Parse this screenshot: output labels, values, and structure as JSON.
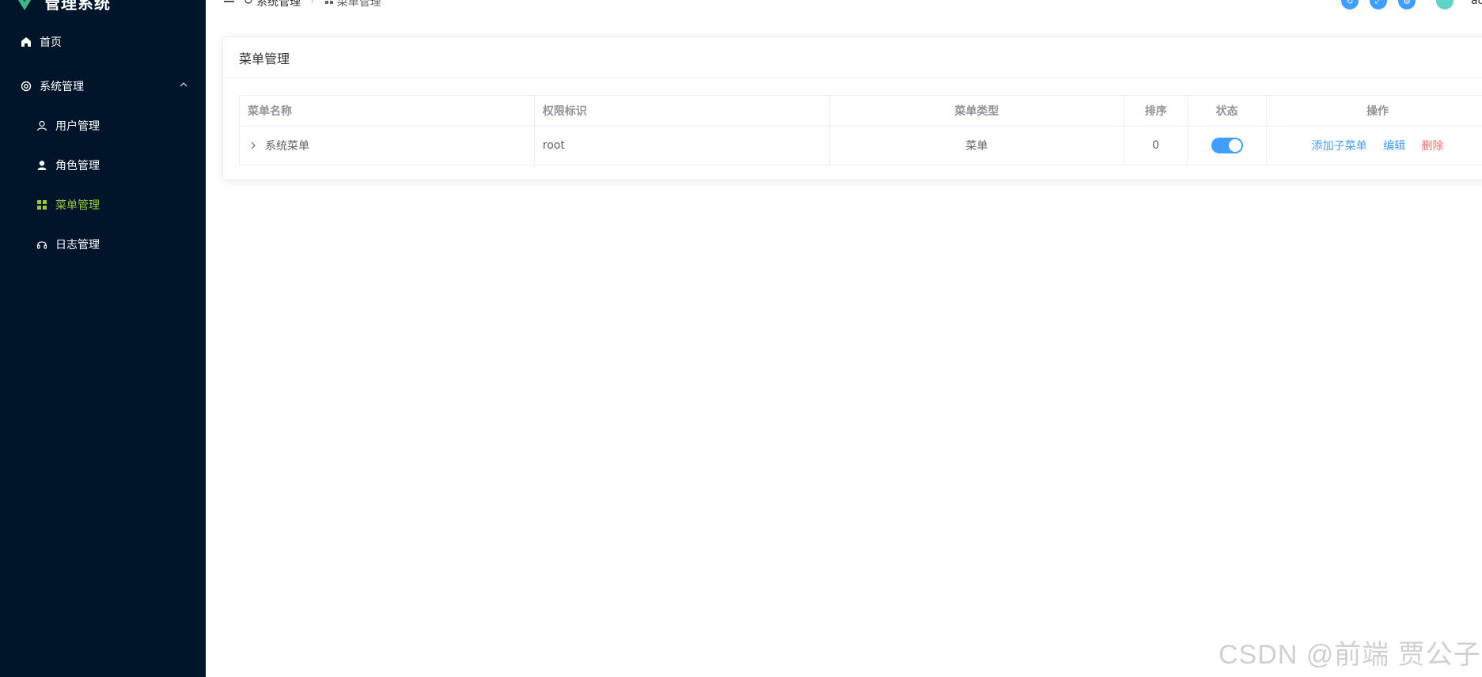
{
  "brand": {
    "title": "管理系统"
  },
  "sidebar": {
    "home_label": "首页",
    "group_label": "系统管理",
    "items": [
      {
        "label": "用户管理",
        "icon": "user-outline-icon"
      },
      {
        "label": "角色管理",
        "icon": "user-filled-icon"
      },
      {
        "label": "菜单管理",
        "icon": "grid-icon",
        "active": true
      },
      {
        "label": "日志管理",
        "icon": "headset-icon"
      }
    ],
    "active_color": "#93c83a"
  },
  "header": {
    "breadcrumb": [
      {
        "label": "系统管理",
        "icon": "gear-icon"
      },
      {
        "label": "菜单管理",
        "icon": "grid-icon"
      }
    ],
    "username": "ad"
  },
  "card": {
    "title": "菜单管理"
  },
  "table": {
    "headers": [
      "菜单名称",
      "权限标识",
      "菜单类型",
      "排序",
      "状态",
      "操作"
    ],
    "rows": [
      {
        "name": "系统菜单",
        "permission": "root",
        "type": "菜单",
        "order": "0",
        "status_on": true,
        "actions": {
          "add_child": "添加子菜单",
          "edit": "编辑",
          "delete": "删除"
        }
      }
    ]
  },
  "colors": {
    "sidebar_bg": "#001529",
    "primary": "#409eff",
    "danger": "#f56c6c"
  },
  "watermark": "CSDN @前端 贾公子"
}
